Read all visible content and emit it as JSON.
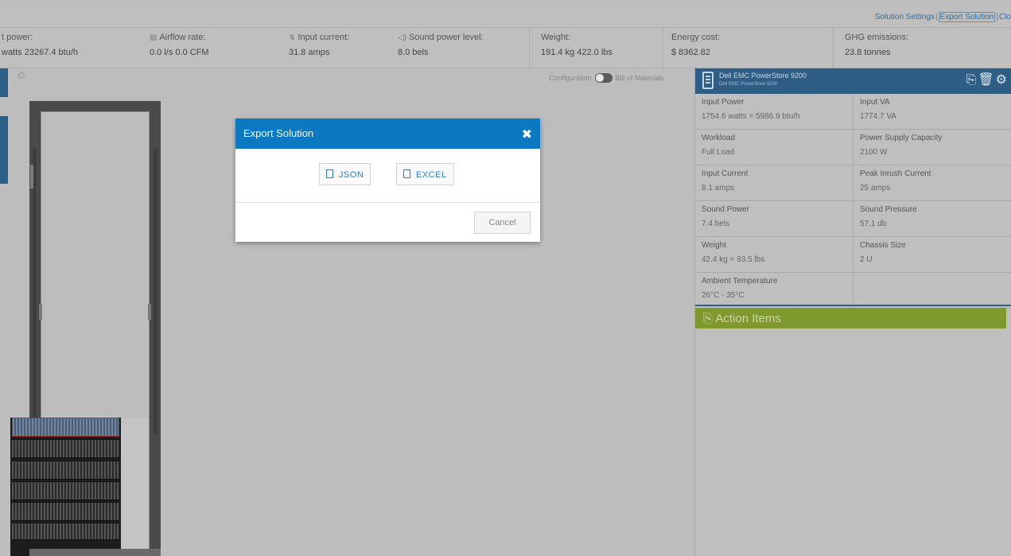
{
  "top_links": {
    "settings": "Solution Settings",
    "sep": "|",
    "export": "Export Solution",
    "close": "Clo"
  },
  "metrics": [
    {
      "label": "t power:",
      "value": "watts 23267.4 btu/h"
    },
    {
      "label": "Airflow rate:",
      "value": "0.0 l/s 0.0 CFM"
    },
    {
      "label": "Input current:",
      "value": "31.8 amps"
    },
    {
      "label": "Sound power level:",
      "value": "8.0 bels"
    },
    {
      "label": "Weight:",
      "value": "191.4 kg 422.0 lbs"
    },
    {
      "label": "Energy cost:",
      "value": "$ 8362.82"
    },
    {
      "label": "GHG emissions:",
      "value": "23.8 tonnes"
    }
  ],
  "view_toggle": {
    "left": "Configuration",
    "right": "Bill of Materials"
  },
  "device": {
    "name": "Dell EMC PowerStore 9200",
    "subname": "Dell EMC PowerStore 9200"
  },
  "specs": [
    {
      "label": "Input Power",
      "value": "1754.6 watts = 5986.9 btu/h"
    },
    {
      "label": "Input VA",
      "value": "1774.7 VA"
    },
    {
      "label": "Workload",
      "value": "Full Load"
    },
    {
      "label": "Power Supply Capacity",
      "value": "2100 W"
    },
    {
      "label": "Input Current",
      "value": "8.1 amps"
    },
    {
      "label": "Peak Inrush Current",
      "value": "25 amps"
    },
    {
      "label": "Sound Power",
      "value": "7.4 bels"
    },
    {
      "label": "Sound Pressure",
      "value": "57.1 db"
    },
    {
      "label": "Weight",
      "value": "42.4 kg = 93.5 lbs"
    },
    {
      "label": "Chassis Size",
      "value": "2 U"
    },
    {
      "label": "Ambient Temperature",
      "value": "26°C - 35°C"
    }
  ],
  "action_items": "Action Items",
  "modal": {
    "title": "Export Solution",
    "json": "JSON",
    "excel": "EXCEL",
    "cancel": "Cancel"
  },
  "colors": {
    "accent": "#0a79c2",
    "panel_header": "#2e5e85",
    "action_bar": "#7e9a2f",
    "overlay": "#bdbdbd"
  }
}
